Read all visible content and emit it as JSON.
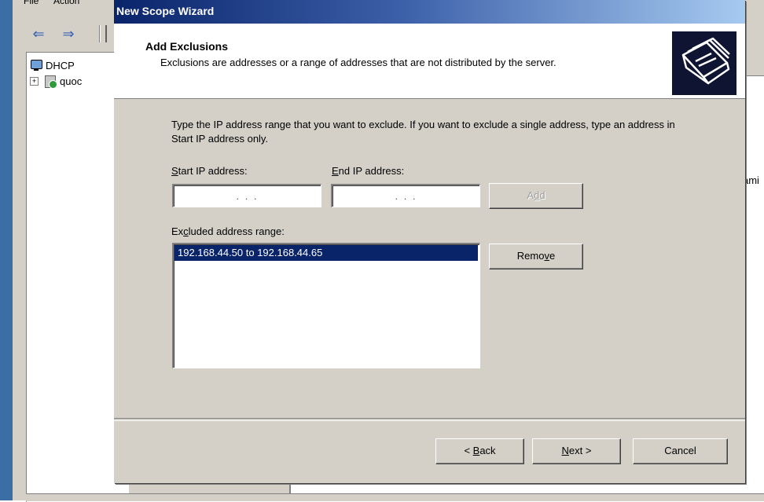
{
  "background_window": {
    "menu_items": [
      "File",
      "Action"
    ],
    "toolbar": {
      "back_icon": "back-arrow-icon",
      "forward_icon": "forward-arrow-icon"
    },
    "tree": {
      "root_label": "DHCP",
      "child_label": "quoc",
      "expander": "+"
    },
    "right_pane_clipped_text": "ami"
  },
  "wizard": {
    "title": "New Scope Wizard",
    "header": {
      "title": "Add Exclusions",
      "subtitle": "Exclusions are addresses or a range of addresses that are not distributed by the server.",
      "icon": "folders-icon"
    },
    "instructions": "Type the IP address range that you want to exclude. If you want to exclude a single address, type an address in Start IP address only.",
    "start_ip": {
      "label_pre": "",
      "label_accel": "S",
      "label_post": "tart IP address:",
      "value": ".   .   ."
    },
    "end_ip": {
      "label_pre": "",
      "label_accel": "E",
      "label_post": "nd IP address:",
      "value": ".   .   ."
    },
    "add_button": {
      "pre": "A",
      "accel": "d",
      "post": "d",
      "enabled": false
    },
    "excluded": {
      "label_pre": "Ex",
      "label_accel": "c",
      "label_post": "luded address range:",
      "items": [
        "192.168.44.50 to 192.168.44.65"
      ],
      "selected_index": 0
    },
    "remove_button": {
      "pre": "Remo",
      "accel": "v",
      "post": "e"
    },
    "back_button": {
      "pre": "< ",
      "accel": "B",
      "post": "ack"
    },
    "next_button": {
      "pre": "",
      "accel": "N",
      "post": "ext >"
    },
    "cancel_button": {
      "label": "Cancel"
    }
  }
}
